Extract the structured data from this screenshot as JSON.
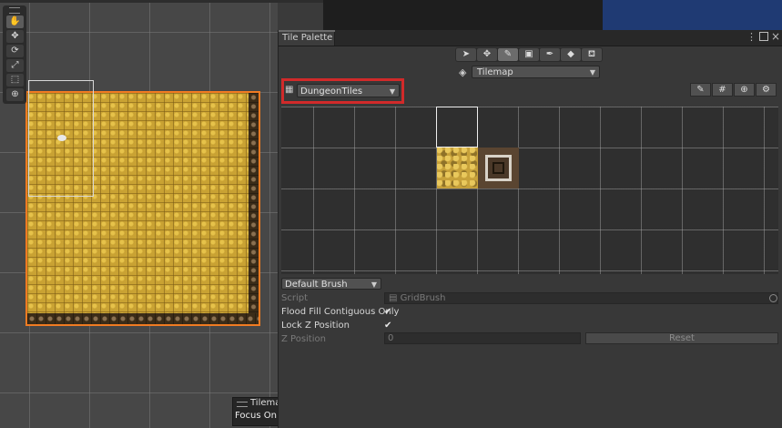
{
  "colors": {
    "selection_outline": "#f07b22",
    "highlight_box": "#d12a2a",
    "tile_yellow": "#c7a13a",
    "panel_bg": "#383838"
  },
  "scene": {
    "tools": [
      "hand-icon",
      "move-icon",
      "rotate-icon",
      "scale-icon",
      "rect-icon",
      "transform-icon"
    ],
    "overlay": {
      "title": "Tilemap",
      "focus_label": "Focus On"
    }
  },
  "palette": {
    "tab_title": "Tile Palette",
    "tools": [
      "select-icon",
      "move-icon",
      "paint-brush-icon",
      "box-fill-icon",
      "picker-icon",
      "eraser-icon",
      "fill-bucket-icon"
    ],
    "active_target": "Tilemap",
    "palette_name": "DungeonTiles",
    "right_tools": [
      "edit-icon",
      "grid-icon",
      "gizmo-icon",
      "settings-icon"
    ]
  },
  "brush": {
    "selected": "Default Brush",
    "script_label": "Script",
    "script_value": "GridBrush",
    "flood_fill_label": "Flood Fill Contiguous Only",
    "flood_fill_checked": true,
    "lock_z_label": "Lock Z Position",
    "lock_z_checked": true,
    "z_position_label": "Z Position",
    "z_position_value": "0",
    "reset_label": "Reset"
  }
}
